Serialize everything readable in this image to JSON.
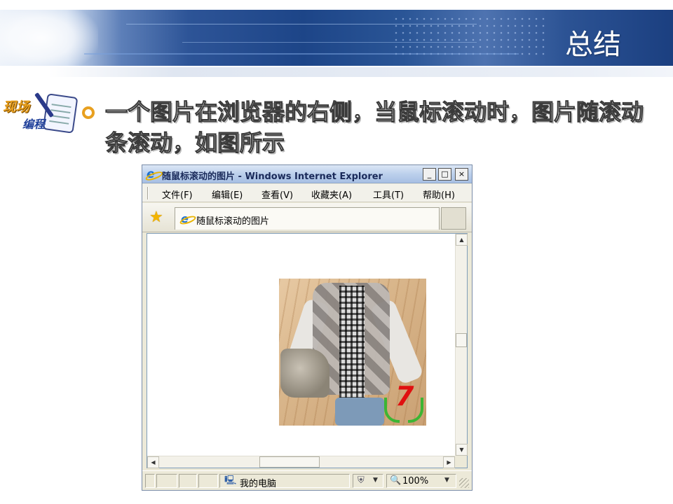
{
  "slide": {
    "title": "总结",
    "logo_text_1": "现场",
    "logo_text_2": "编程",
    "bullet": "一个图片在浏览器的右侧，当鼠标滚动时，图片随滚动条滚动，如图所示",
    "colors": {
      "banner_blue": "#1d4588",
      "bullet_orange": "#e8a020"
    }
  },
  "browser": {
    "window_title": "随鼠标滚动的图片 - Windows Internet Explorer",
    "window_buttons": {
      "minimize": "_",
      "maximize": "□",
      "close": "×"
    },
    "menu": [
      "文件(F)",
      "编辑(E)",
      "查看(V)",
      "收藏夹(A)",
      "工具(T)",
      "帮助(H)"
    ],
    "tab_label": "随鼠标滚动的图片",
    "favorites_icon": "star-icon",
    "page_image": {
      "brand_mark": "7"
    },
    "status": {
      "zone": "我的电脑",
      "zoom": "100%"
    }
  }
}
